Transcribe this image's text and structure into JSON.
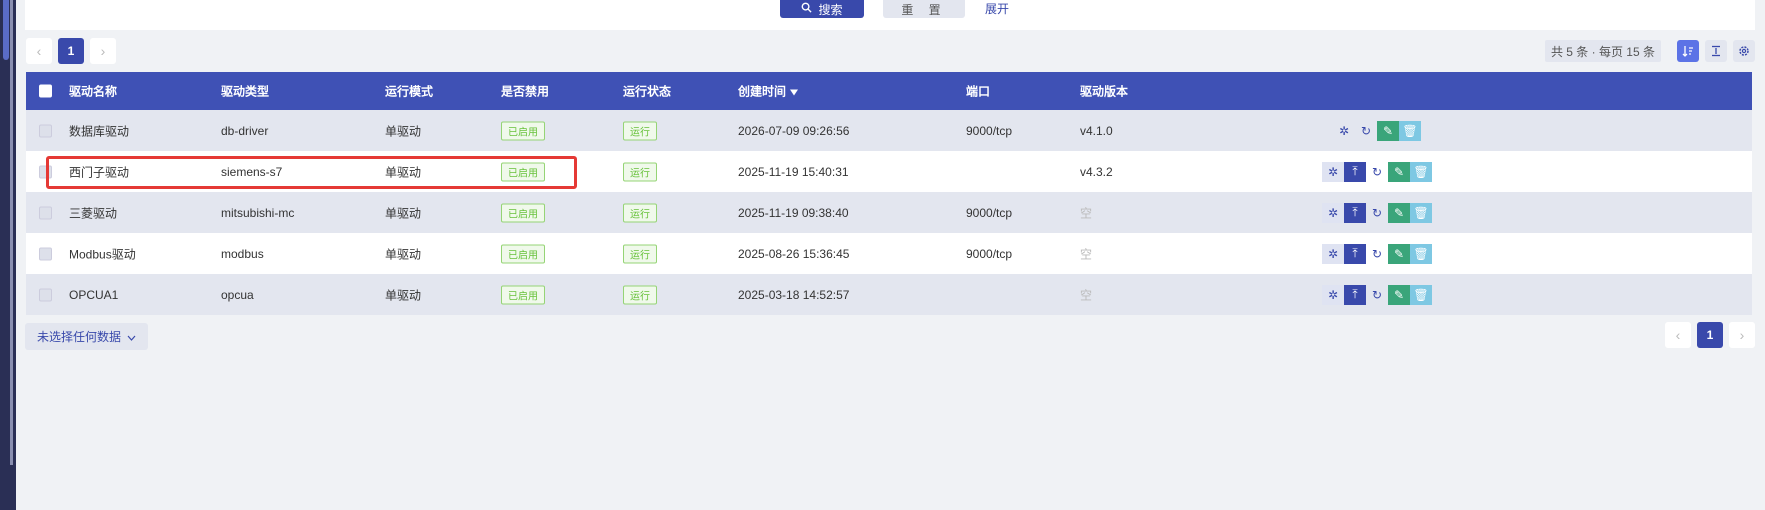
{
  "search": {
    "search_label": "搜索",
    "reset_label": "重 置",
    "expand_label": "展开"
  },
  "pager": {
    "prev": "‹",
    "next": "›",
    "current": "1",
    "total_text": "共 5 条 · 每页 15 条"
  },
  "table": {
    "headers": {
      "name": "驱动名称",
      "type": "驱动类型",
      "mode": "运行模式",
      "disabled": "是否禁用",
      "status": "运行状态",
      "created": "创建时间",
      "port": "端口",
      "version": "驱动版本"
    },
    "rows": [
      {
        "name": "数据库驱动",
        "type": "db-driver",
        "mode": "单驱动",
        "disabled": "已启用",
        "status": "运行",
        "created": "2026-07-09 09:26:56",
        "port": "9000/tcp",
        "version": "v4.1.0"
      },
      {
        "name": "西门子驱动",
        "type": "siemens-s7",
        "mode": "单驱动",
        "disabled": "已启用",
        "status": "运行",
        "created": "2025-11-19 15:40:31",
        "port": "",
        "version": "v4.3.2"
      },
      {
        "name": "三菱驱动",
        "type": "mitsubishi-mc",
        "mode": "单驱动",
        "disabled": "已启用",
        "status": "运行",
        "created": "2025-11-19 09:38:40",
        "port": "9000/tcp",
        "version": "空"
      },
      {
        "name": "Modbus驱动",
        "type": "modbus",
        "mode": "单驱动",
        "disabled": "已启用",
        "status": "运行",
        "created": "2025-08-26 15:36:45",
        "port": "9000/tcp",
        "version": "空"
      },
      {
        "name": "OPCUA1",
        "type": "opcua",
        "mode": "单驱动",
        "disabled": "已启用",
        "status": "运行",
        "created": "2025-03-18 14:52:57",
        "port": "",
        "version": "空"
      }
    ]
  },
  "footer": {
    "selection_label": "未选择任何数据"
  }
}
